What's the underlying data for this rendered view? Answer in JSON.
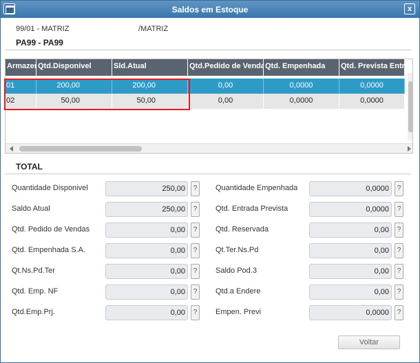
{
  "window": {
    "title": "Saldos em Estoque"
  },
  "header": {
    "branch": "99/01 - MATRIZ",
    "company": "/MATRIZ",
    "product": "PA99 - PA99"
  },
  "grid": {
    "columns": [
      "Armazem",
      "Qtd.Disponivel",
      "Sld.Atual",
      "Qtd.Pedido de Vendas",
      "Qtd. Empenhada",
      "Qtd. Prevista Entrada"
    ],
    "rows": [
      [
        "01",
        "200,00",
        "200,00",
        "0,00",
        "0,0000",
        "0,0000"
      ],
      [
        "02",
        "50,00",
        "50,00",
        "0,00",
        "0,0000",
        "0,0000"
      ]
    ]
  },
  "total": {
    "title": "TOTAL",
    "left": [
      {
        "label": "Quantidade Disponivel",
        "value": "250,00"
      },
      {
        "label": "Saldo Atual",
        "value": "250,00"
      },
      {
        "label": "Qtd. Pedido de Vendas",
        "value": "0,00"
      },
      {
        "label": "Qtd. Empenhada S.A.",
        "value": "0,00"
      },
      {
        "label": "Qt.Ns.Pd.Ter",
        "value": "0,00"
      },
      {
        "label": "Qtd. Emp. NF",
        "value": "0,00"
      },
      {
        "label": "Qtd.Emp.Prj.",
        "value": "0,00"
      }
    ],
    "right": [
      {
        "label": "Quantidade Empenhada",
        "value": "0,0000"
      },
      {
        "label": "Qtd. Entrada Prevista",
        "value": "0,0000"
      },
      {
        "label": "Qtd. Reservada",
        "value": "0,00"
      },
      {
        "label": "Qt.Ter.Ns.Pd",
        "value": "0,00"
      },
      {
        "label": "Saldo Pod.3",
        "value": "0,00"
      },
      {
        "label": "Qtd.a Endere",
        "value": "0,00"
      },
      {
        "label": "Empen. Previ",
        "value": "0,0000"
      }
    ],
    "help_label": "?"
  },
  "actions": {
    "voltar": "Voltar",
    "close": "x"
  },
  "colors": {
    "titlebar": "#3a76ab",
    "grid_header": "#5a6470",
    "selected_row": "#2e9bc7",
    "highlight": "#e41d1d"
  }
}
